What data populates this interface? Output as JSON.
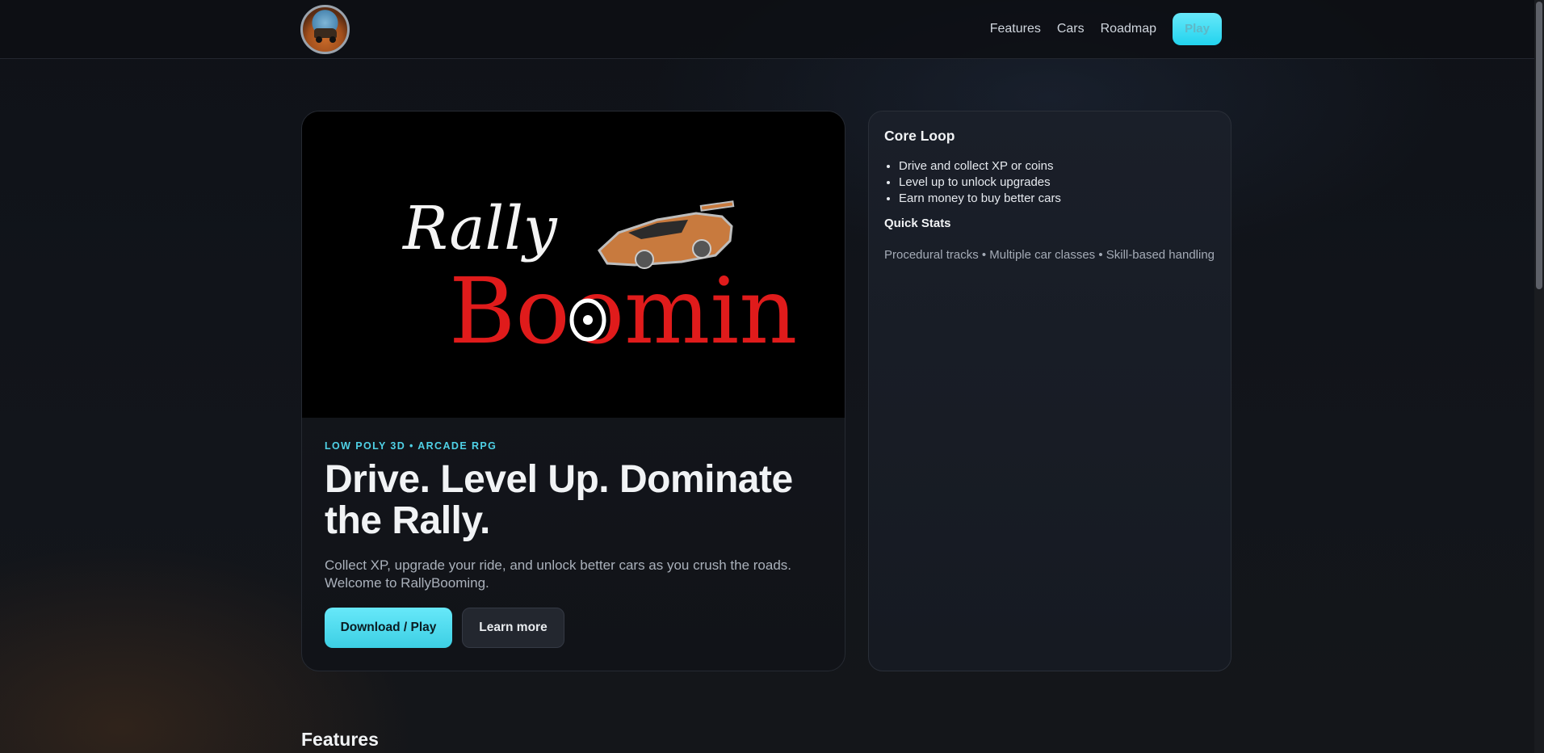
{
  "nav": {
    "items": [
      "Features",
      "Cars",
      "Roadmap"
    ],
    "play_label": "Play"
  },
  "hero": {
    "eyebrow": "LOW POLY 3D • ARCADE RPG",
    "headline": "Drive. Level Up. Dominate the Rally.",
    "lede": "Collect XP, upgrade your ride, and unlock better cars as you crush the roads. Welcome to RallyBooming.",
    "primary_cta": "Download / Play",
    "secondary_cta": "Learn more",
    "art_text_1": "Rally",
    "art_text_2": "Boomin"
  },
  "sidebar": {
    "core_loop_title": "Core Loop",
    "core_loop_items": [
      "Drive and collect XP or coins",
      "Level up to unlock upgrades",
      "Earn money to buy better cars"
    ],
    "quick_stats_title": "Quick Stats",
    "quick_stats_text": "Procedural tracks • Multiple car classes • Skill-based handling"
  },
  "sections": {
    "features_title": "Features"
  },
  "colors": {
    "accent": "#22d3ee",
    "background": "#0f1218",
    "card": "#1a1f29"
  }
}
